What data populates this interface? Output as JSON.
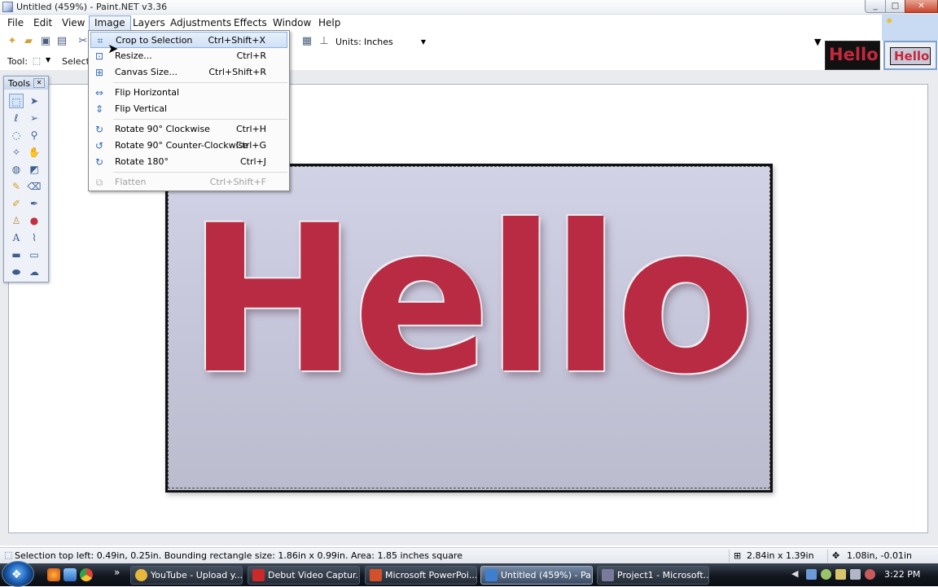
{
  "window": {
    "title": "Untitled (459%) - Paint.NET v3.36",
    "min": "0",
    "max": "1",
    "close": "r"
  },
  "menubar": {
    "items": [
      "File",
      "Edit",
      "View",
      "Image",
      "Layers",
      "Adjustments",
      "Effects",
      "Window",
      "Help"
    ],
    "active": "Image"
  },
  "toolbar": {
    "tool_label": "Tool:",
    "selection_label": "Selectio",
    "units_label": "Units:",
    "units_value": "Inches"
  },
  "thumbnails": [
    {
      "text": "Hello",
      "theme": "dark"
    },
    {
      "text": "Hello",
      "theme": "light"
    }
  ],
  "tools_panel": {
    "title": "Tools",
    "icons": [
      "rect-select-icon",
      "move-selection-icon",
      "lasso-icon",
      "move-pixels-icon",
      "ellipse-select-icon",
      "zoom-icon",
      "magic-wand-icon",
      "pan-icon",
      "paint-bucket-icon",
      "gradient-icon",
      "pencil-icon",
      "eraser-icon",
      "paintbrush-icon",
      "color-picker-icon",
      "clone-stamp-icon",
      "recolor-icon",
      "text-icon",
      "line-curve-icon",
      "rectangle-icon",
      "rounded-rect-icon",
      "ellipse-icon",
      "freeform-shape-icon"
    ]
  },
  "image_menu": {
    "items": [
      {
        "label": "Crop to Selection",
        "shortcut": "Ctrl+Shift+X",
        "icon": "crop-icon",
        "highlighted": true
      },
      {
        "label": "Resize...",
        "shortcut": "Ctrl+R",
        "icon": "resize-icon"
      },
      {
        "label": "Canvas Size...",
        "shortcut": "Ctrl+Shift+R",
        "icon": "canvas-size-icon"
      },
      {
        "label": "Flip Horizontal",
        "shortcut": "",
        "icon": "flip-horizontal-icon"
      },
      {
        "label": "Flip Vertical",
        "shortcut": "",
        "icon": "flip-vertical-icon"
      },
      {
        "label": "Rotate 90° Clockwise",
        "shortcut": "Ctrl+H",
        "icon": "rotate-cw-icon"
      },
      {
        "label": "Rotate 90° Counter-Clockwise",
        "shortcut": "Ctrl+G",
        "icon": "rotate-ccw-icon"
      },
      {
        "label": "Rotate 180°",
        "shortcut": "Ctrl+J",
        "icon": "rotate-180-icon"
      },
      {
        "label": "Flatten",
        "shortcut": "Ctrl+Shift+F",
        "icon": "flatten-icon",
        "disabled": true
      }
    ]
  },
  "canvas": {
    "image_text": "Hello",
    "text_color": "#b92b42"
  },
  "statusbar": {
    "message": "Selection top left: 0.49in, 0.25in. Bounding rectangle size: 1.86in x 0.99in. Area: 1.85 inches square",
    "image_size": "2.84in x 1.39in",
    "cursor_pos": "1.08in, -0.01in"
  },
  "taskbar": {
    "tasks": [
      {
        "label": "YouTube - Upload y...",
        "icon_color": "#e8b83a"
      },
      {
        "label": "Debut Video Captur...",
        "icon_color": "#cc2a2a"
      },
      {
        "label": "Microsoft PowerPoi...",
        "icon_color": "#d2512b"
      },
      {
        "label": "Untitled (459%) - Pa...",
        "icon_color": "#3f7fd0",
        "active": true
      },
      {
        "label": "Project1 - Microsoft...",
        "icon_color": "#7a7a9a"
      }
    ],
    "clock": "3:22 PM",
    "quick_launch": [
      "firefox-icon",
      "show-desktop-icon",
      "chrome-icon"
    ],
    "overflow": "»"
  }
}
